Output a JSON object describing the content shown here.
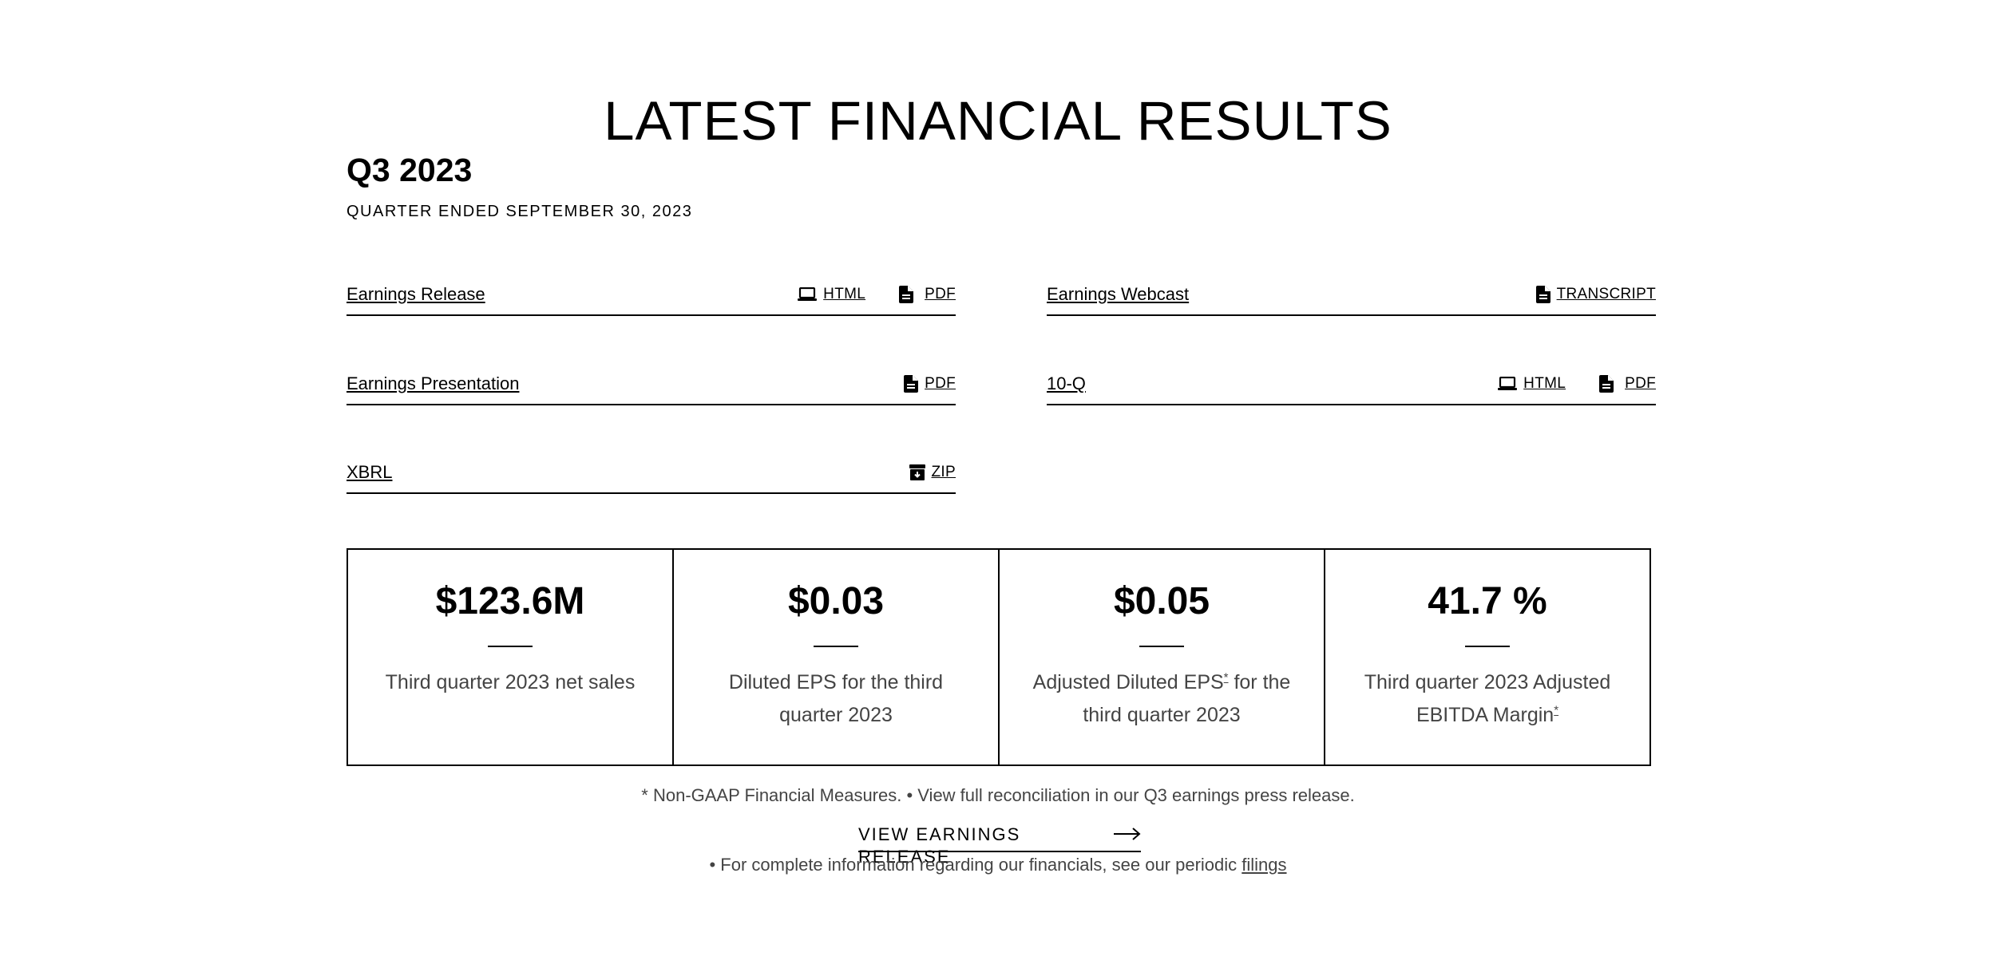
{
  "header": {
    "title": "LATEST FINANCIAL RESULTS",
    "quarter": "Q3 2023",
    "quarter_subtitle": "QUARTER ENDED SEPTEMBER 30, 2023"
  },
  "documents": [
    {
      "label": "Earnings Release",
      "links": [
        {
          "icon": "laptop-icon",
          "label": "HTML"
        },
        {
          "icon": "document-icon",
          "label": "PDF"
        }
      ]
    },
    {
      "label": "Earnings Webcast",
      "links": [
        {
          "icon": "document-icon",
          "label": "TRANSCRIPT"
        }
      ]
    },
    {
      "label": "Earnings Presentation",
      "links": [
        {
          "icon": "document-icon",
          "label": "PDF"
        }
      ]
    },
    {
      "label": "10-Q",
      "links": [
        {
          "icon": "laptop-icon",
          "label": "HTML"
        },
        {
          "icon": "document-icon",
          "label": "PDF"
        }
      ]
    },
    {
      "label": "XBRL",
      "links": [
        {
          "icon": "archive-icon",
          "label": "ZIP"
        }
      ]
    }
  ],
  "stats": [
    {
      "value": "$123.6M",
      "desc": "Third quarter 2023 net sales"
    },
    {
      "value": "$0.03",
      "desc": "Diluted EPS for the third quarter 2023"
    },
    {
      "value": "$0.05",
      "desc_before": "Adjusted Diluted EPS",
      "asterisk": "*",
      "desc_after": " for the third quarter 2023"
    },
    {
      "value": "41.7 %",
      "desc_before": "Third quarter 2023 Adjusted EBITDA Margin",
      "asterisk": "*"
    }
  ],
  "footnote": "* Non-GAAP Financial Measures. • View full reconciliation in our Q3 earnings press release.",
  "cta": {
    "label": "VIEW EARNINGS RELEASE",
    "icon": "arrow-right-icon"
  },
  "more_info": {
    "text": "• For complete information regarding our financials, see our periodic ",
    "link": "filings"
  }
}
